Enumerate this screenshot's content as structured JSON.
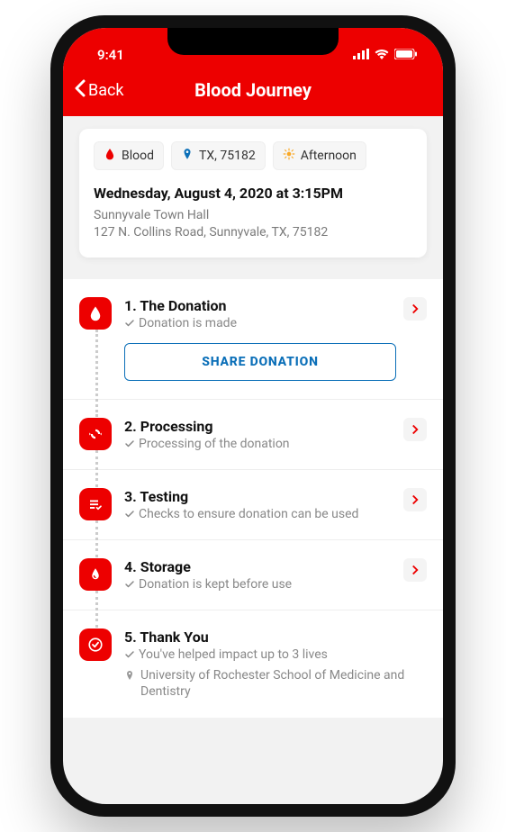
{
  "status": {
    "time": "9:41"
  },
  "nav": {
    "back_label": "Back",
    "title": "Blood Journey"
  },
  "chips": {
    "blood": "Blood",
    "location": "TX, 75182",
    "time": "Afternoon"
  },
  "appointment": {
    "datetime": "Wednesday, August 4, 2020 at 3:15PM",
    "venue": "Sunnyvale Town Hall",
    "address": "127 N. Collins Road, Sunnyvale, TX, 75182"
  },
  "steps": [
    {
      "title": "1. The Donation",
      "subtitle": "Donation is made",
      "share_label": "SHARE DONATION"
    },
    {
      "title": "2. Processing",
      "subtitle": "Processing of the donation"
    },
    {
      "title": "3. Testing",
      "subtitle": "Checks to ensure donation can be used"
    },
    {
      "title": "4. Storage",
      "subtitle": "Donation is kept before use"
    },
    {
      "title": "5. Thank You",
      "subtitle": "You've helped impact up to 3 lives",
      "location": "University of Rochester School of Medicine and Dentistry"
    }
  ]
}
